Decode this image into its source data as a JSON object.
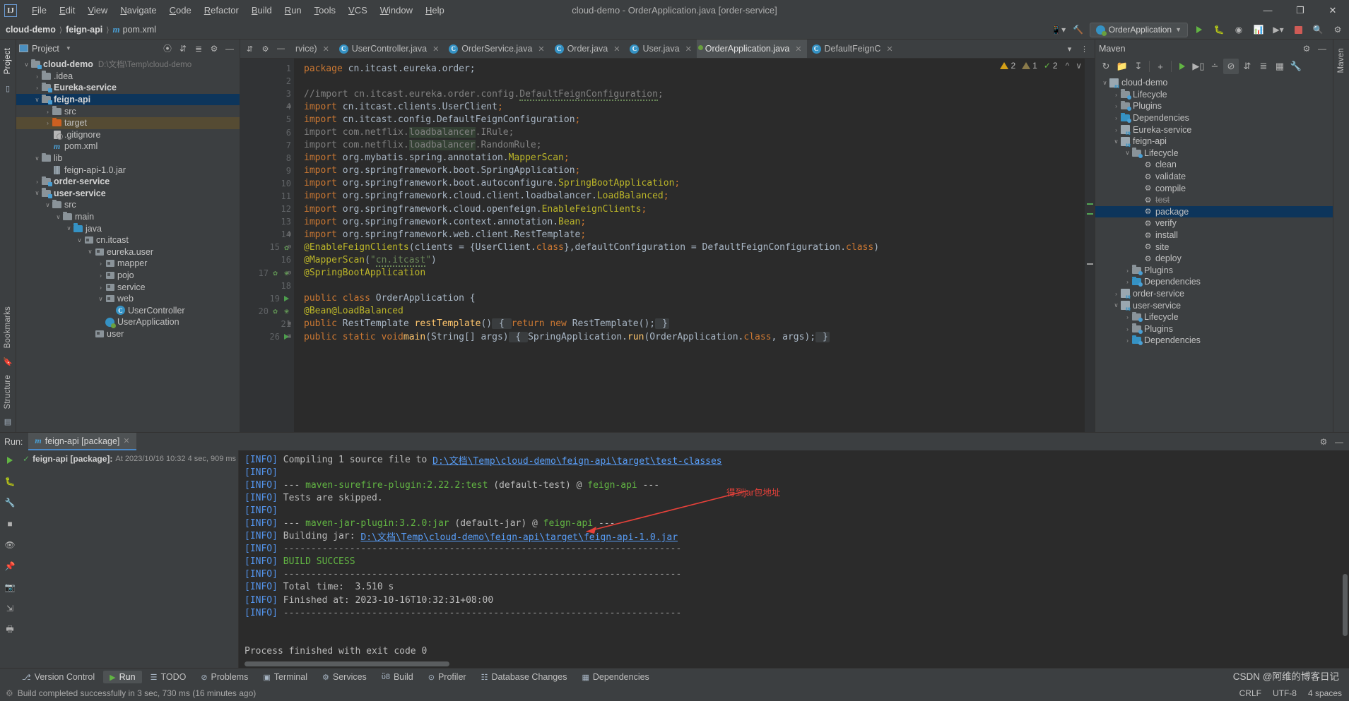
{
  "window": {
    "title": "cloud-demo - OrderApplication.java [order-service]",
    "logo": "IJ",
    "minimize": "—",
    "maximize": "❐",
    "close": "✕"
  },
  "menu": [
    "File",
    "Edit",
    "View",
    "Navigate",
    "Code",
    "Refactor",
    "Build",
    "Run",
    "Tools",
    "VCS",
    "Window",
    "Help"
  ],
  "navbar": {
    "breadcrumbs": [
      "cloud-demo",
      "feign-api",
      "pom.xml"
    ],
    "run_config": "OrderApplication",
    "icons": [
      "device-manager-icon",
      "build-hammer-icon",
      "run-icon",
      "debug-icon",
      "profiler-icon",
      "coverage-icon",
      "more-run-icon",
      "stop-icon",
      "search-everywhere-icon",
      "settings-icon"
    ]
  },
  "left_strip": {
    "tabs": [
      "Project"
    ],
    "bottom_tabs": [
      "Bookmarks",
      "Structure"
    ]
  },
  "project_panel": {
    "title": "Project",
    "header_icons": [
      "locate-icon",
      "collapse-all-icon",
      "expand-icon",
      "settings-icon",
      "hide-icon"
    ],
    "tree": [
      {
        "depth": 0,
        "arrow": "∨",
        "icon": "module-folder",
        "label": "cloud-demo",
        "bold": true,
        "hint": "D:\\文档\\Temp\\cloud-demo"
      },
      {
        "depth": 1,
        "arrow": "›",
        "icon": "folder",
        "label": ".idea"
      },
      {
        "depth": 1,
        "arrow": "›",
        "icon": "module-folder",
        "label": "Eureka-service",
        "bold": true
      },
      {
        "depth": 1,
        "arrow": "∨",
        "icon": "module-folder",
        "label": "feign-api",
        "bold": true,
        "state": "selected"
      },
      {
        "depth": 2,
        "arrow": "›",
        "icon": "folder",
        "label": "src"
      },
      {
        "depth": 2,
        "arrow": "›",
        "icon": "folder-orange",
        "label": "target",
        "state": "secondary"
      },
      {
        "depth": 2,
        "arrow": "",
        "icon": "gitignore",
        "label": ".gitignore"
      },
      {
        "depth": 2,
        "arrow": "",
        "icon": "maven-m",
        "label": "pom.xml"
      },
      {
        "depth": 1,
        "arrow": "∨",
        "icon": "folder",
        "label": "lib"
      },
      {
        "depth": 2,
        "arrow": "",
        "icon": "jar",
        "label": "feign-api-1.0.jar"
      },
      {
        "depth": 1,
        "arrow": "›",
        "icon": "module-folder",
        "label": "order-service",
        "bold": true
      },
      {
        "depth": 1,
        "arrow": "∨",
        "icon": "module-folder",
        "label": "user-service",
        "bold": true
      },
      {
        "depth": 2,
        "arrow": "∨",
        "icon": "folder",
        "label": "src"
      },
      {
        "depth": 3,
        "arrow": "∨",
        "icon": "folder",
        "label": "main"
      },
      {
        "depth": 4,
        "arrow": "∨",
        "icon": "folder-blue",
        "label": "java"
      },
      {
        "depth": 5,
        "arrow": "∨",
        "icon": "package",
        "label": "cn.itcast"
      },
      {
        "depth": 6,
        "arrow": "∨",
        "icon": "package",
        "label": "eureka.user"
      },
      {
        "depth": 7,
        "arrow": "›",
        "icon": "package",
        "label": "mapper"
      },
      {
        "depth": 7,
        "arrow": "›",
        "icon": "package",
        "label": "pojo"
      },
      {
        "depth": 7,
        "arrow": "›",
        "icon": "package",
        "label": "service"
      },
      {
        "depth": 7,
        "arrow": "∨",
        "icon": "package",
        "label": "web"
      },
      {
        "depth": 8,
        "arrow": "",
        "icon": "class",
        "label": "UserController"
      },
      {
        "depth": 7,
        "arrow": "",
        "icon": "spring-class",
        "label": "UserApplication"
      },
      {
        "depth": 6,
        "arrow": "",
        "icon": "package",
        "label": "user"
      }
    ]
  },
  "editor": {
    "lead_icons": [
      "collapse-icon",
      "settings-icon",
      "hide-icon"
    ],
    "tabs": [
      {
        "label": "rvice)",
        "icon": "",
        "active": false,
        "partial": true
      },
      {
        "label": "UserController.java",
        "icon": "class",
        "active": false
      },
      {
        "label": "OrderService.java",
        "icon": "class",
        "active": false
      },
      {
        "label": "Order.java",
        "icon": "class",
        "active": false
      },
      {
        "label": "User.java",
        "icon": "class",
        "active": false
      },
      {
        "label": "OrderApplication.java",
        "icon": "spring-class",
        "active": true
      },
      {
        "label": "DefaultFeignC",
        "icon": "class",
        "active": false
      }
    ],
    "tail_icons": [
      "chevron-down-icon",
      "more-vertical-icon"
    ],
    "inspection": {
      "warnings": "2",
      "weak_warnings": "1",
      "checks": "2",
      "up": "⌃",
      "down": "⌄"
    },
    "lines": [
      {
        "n": "1",
        "marks": [],
        "fold": "",
        "html": "<span class=\"kw\">package</span> cn.itcast.eureka.order;"
      },
      {
        "n": "2",
        "marks": [],
        "fold": "",
        "html": ""
      },
      {
        "n": "3",
        "marks": [],
        "fold": "",
        "html": "<span class=\"cmt\">//import cn.itcast.eureka.order.config.<span class=\"squig\">DefaultFeignConfiguration</span>;</span>"
      },
      {
        "n": "4",
        "marks": [],
        "fold": "⊖",
        "html": "<span class=\"kw\">import</span> cn.itcast.clients.UserClient<span class=\"kw\">;</span>"
      },
      {
        "n": "5",
        "marks": [],
        "fold": "",
        "html": "<span class=\"kw\">import</span> cn.itcast.config.DefaultFeignConfiguration<span class=\"kw\">;</span>"
      },
      {
        "n": "6",
        "marks": [],
        "fold": "",
        "html": "<span class=\"gray\">import com.netflix.<span class=\"hl\">loadbalancer</span>.IRule;</span>"
      },
      {
        "n": "7",
        "marks": [],
        "fold": "",
        "html": "<span class=\"gray\">import com.netflix.<span class=\"hl\">loadbalancer</span>.RandomRule;</span>"
      },
      {
        "n": "8",
        "marks": [],
        "fold": "",
        "html": "<span class=\"kw\">import</span> org.mybatis.spring.annotation.<span class=\"ann\">MapperScan</span><span class=\"kw\">;</span>"
      },
      {
        "n": "9",
        "marks": [],
        "fold": "",
        "html": "<span class=\"kw\">import</span> org.springframework.boot.SpringApplication<span class=\"kw\">;</span>"
      },
      {
        "n": "10",
        "marks": [],
        "fold": "",
        "html": "<span class=\"kw\">import</span> org.springframework.boot.autoconfigure.<span class=\"ann\">SpringBootApplication</span><span class=\"kw\">;</span>"
      },
      {
        "n": "11",
        "marks": [],
        "fold": "",
        "html": "<span class=\"kw\">import</span> org.springframework.cloud.client.loadbalancer.<span class=\"ann\">LoadBalanced</span><span class=\"kw\">;</span>"
      },
      {
        "n": "12",
        "marks": [],
        "fold": "",
        "html": "<span class=\"kw\">import</span> org.springframework.cloud.openfeign.<span class=\"ann\">EnableFeignClients</span><span class=\"kw\">;</span>"
      },
      {
        "n": "13",
        "marks": [],
        "fold": "",
        "html": "<span class=\"kw\">import</span> org.springframework.context.annotation.<span class=\"ann\">Bean</span><span class=\"kw\">;</span>"
      },
      {
        "n": "14",
        "marks": [],
        "fold": "⊖",
        "html": "<span class=\"kw\">import</span> org.springframework.web.client.RestTemplate<span class=\"kw\">;</span>"
      },
      {
        "n": "15",
        "marks": [
          "bean"
        ],
        "fold": "⊖",
        "html": "<span class=\"ann\">@EnableFeignClients</span>(clients = {UserClient.<span class=\"kw\">class</span>},defaultConfiguration = DefaultFeignConfiguration.<span class=\"kw\">class</span>)"
      },
      {
        "n": "16",
        "marks": [],
        "fold": "",
        "html": "<span class=\"ann\">@MapperScan</span>(<span class=\"str\">\"<span class=\"squig\">cn.itcast</span>\"</span>)"
      },
      {
        "n": "17",
        "marks": [
          "bean",
          "leaf"
        ],
        "fold": "⊖",
        "html": "<span class=\"ann\">@SpringBootApplication</span>"
      },
      {
        "n": "18",
        "marks": [],
        "fold": "",
        "html": ""
      },
      {
        "n": "19",
        "marks": [
          "run"
        ],
        "fold": "",
        "html": "<span class=\"kw\">public class</span> OrderApplication {"
      },
      {
        "n": "20",
        "marks": [
          "bean",
          "leaf"
        ],
        "fold": "",
        "html": "    <span class=\"ann\">@Bean</span> <span class=\"ann\">@LoadBalanced</span>"
      },
      {
        "n": "21",
        "marks": [],
        "fold": "⊞",
        "html": "    <span class=\"kw\">public</span> RestTemplate <span class=\"meth\">restTemplate</span>()<span class=\"codefold\"> { </span><span class=\"kw\">return new</span> RestTemplate();<span class=\"codefold\"> }</span>"
      },
      {
        "n": "26",
        "marks": [
          "run"
        ],
        "fold": "⊞",
        "html": "    <span class=\"kw\">public static void</span> <span class=\"meth\">main</span>(String[] args)<span class=\"codefold\"> { </span>SpringApplication.<span class=\"meth\">run</span>(OrderApplication.<span class=\"kw\">class</span>, args);<span class=\"codefold\"> }</span>"
      }
    ]
  },
  "maven_panel": {
    "title": "Maven",
    "header_icons": [
      "settings-icon",
      "hide-icon"
    ],
    "toolbar_icons": [
      "refresh-icon",
      "add-maven-project-icon",
      "download-sources-icon",
      "add-icon",
      "run-icon",
      "execute-goal-icon",
      "toggle-skip-tests-icon",
      "toggle-offline-icon",
      "collapse-all-icon",
      "expand-all-icon",
      "show-diagram-icon",
      "settings-icon"
    ],
    "tree": [
      {
        "depth": 0,
        "arrow": "∨",
        "icon": "maven-project",
        "label": "cloud-demo"
      },
      {
        "depth": 1,
        "arrow": "›",
        "icon": "lifecycle-folder",
        "label": "Lifecycle"
      },
      {
        "depth": 1,
        "arrow": "›",
        "icon": "plugins-folder",
        "label": "Plugins"
      },
      {
        "depth": 1,
        "arrow": "›",
        "icon": "deps-folder",
        "label": "Dependencies"
      },
      {
        "depth": 1,
        "arrow": "›",
        "icon": "maven-project",
        "label": "Eureka-service"
      },
      {
        "depth": 1,
        "arrow": "∨",
        "icon": "maven-project",
        "label": "feign-api"
      },
      {
        "depth": 2,
        "arrow": "∨",
        "icon": "lifecycle-folder",
        "label": "Lifecycle"
      },
      {
        "depth": 3,
        "arrow": "",
        "icon": "goal",
        "label": "clean"
      },
      {
        "depth": 3,
        "arrow": "",
        "icon": "goal",
        "label": "validate"
      },
      {
        "depth": 3,
        "arrow": "",
        "icon": "goal",
        "label": "compile"
      },
      {
        "depth": 3,
        "arrow": "",
        "icon": "goal",
        "label": "test",
        "state": "struck"
      },
      {
        "depth": 3,
        "arrow": "",
        "icon": "goal",
        "label": "package",
        "state": "selected"
      },
      {
        "depth": 3,
        "arrow": "",
        "icon": "goal",
        "label": "verify"
      },
      {
        "depth": 3,
        "arrow": "",
        "icon": "goal",
        "label": "install"
      },
      {
        "depth": 3,
        "arrow": "",
        "icon": "goal",
        "label": "site"
      },
      {
        "depth": 3,
        "arrow": "",
        "icon": "goal",
        "label": "deploy"
      },
      {
        "depth": 2,
        "arrow": "›",
        "icon": "plugins-folder",
        "label": "Plugins"
      },
      {
        "depth": 2,
        "arrow": "›",
        "icon": "deps-folder",
        "label": "Dependencies"
      },
      {
        "depth": 1,
        "arrow": "›",
        "icon": "maven-project",
        "label": "order-service"
      },
      {
        "depth": 1,
        "arrow": "∨",
        "icon": "maven-project",
        "label": "user-service"
      },
      {
        "depth": 2,
        "arrow": "›",
        "icon": "lifecycle-folder",
        "label": "Lifecycle"
      },
      {
        "depth": 2,
        "arrow": "›",
        "icon": "plugins-folder",
        "label": "Plugins"
      },
      {
        "depth": 2,
        "arrow": "›",
        "icon": "deps-folder",
        "label": "Dependencies"
      }
    ]
  },
  "run_panel": {
    "label": "Run:",
    "tab": "feign-api [package]",
    "header_icons": [
      "settings-icon",
      "hide-icon"
    ],
    "side_icons": [
      "rerun-icon",
      "debug-icon",
      "wrench-icon",
      "stop-icon",
      "eye-icon",
      "pin-icon",
      "camera-icon",
      "export-icon",
      "print-icon"
    ],
    "tree_item": {
      "status": "✓",
      "name": "feign-api [package]:",
      "meta": "At 2023/10/16 10:32 4 sec, 909 ms"
    },
    "right_icons": [
      "wrap-icon",
      "scroll-end-icon",
      "settings2-icon"
    ],
    "console": [
      {
        "tag": "[INFO]",
        "text": " Compiling 1 source file to ",
        "link": "D:\\文档\\Temp\\cloud-demo\\feign-api\\target\\test-classes"
      },
      {
        "tag": "[INFO]",
        "text": ""
      },
      {
        "tag": "[INFO]",
        "text": " --- ",
        "plugin": "maven-surefire-plugin:2.22.2:test",
        "mid": " (default-test) @ ",
        "module": "feign-api",
        "tail": " ---"
      },
      {
        "tag": "[INFO]",
        "text": " Tests are skipped."
      },
      {
        "tag": "[INFO]",
        "text": ""
      },
      {
        "tag": "[INFO]",
        "text": " --- ",
        "plugin": "maven-jar-plugin:3.2.0:jar",
        "mid": " (default-jar) @ ",
        "module": "feign-api",
        "tail": " ---"
      },
      {
        "tag": "[INFO]",
        "text": " Building jar: ",
        "link": "D:\\文档\\Temp\\cloud-demo\\feign-api\\target\\feign-api-1.0.jar"
      },
      {
        "tag": "[INFO]",
        "text": " ------------------------------------------------------------------------",
        "dash": true
      },
      {
        "tag": "[INFO]",
        "text": " BUILD SUCCESS",
        "success": true
      },
      {
        "tag": "[INFO]",
        "text": " ------------------------------------------------------------------------",
        "dash": true
      },
      {
        "tag": "[INFO]",
        "text": " Total time:  3.510 s"
      },
      {
        "tag": "[INFO]",
        "text": " Finished at: 2023-10-16T10:32:31+08:00"
      },
      {
        "tag": "[INFO]",
        "text": " ------------------------------------------------------------------------",
        "dash": true
      },
      {
        "tag": "",
        "text": ""
      },
      {
        "tag": "",
        "text": ""
      },
      {
        "tag": "",
        "text": "Process finished with exit code 0"
      }
    ],
    "annotation": "得到jar包地址"
  },
  "toolwindow_bar": [
    {
      "label": "Version Control",
      "icon": "branch-icon",
      "active": false
    },
    {
      "label": "Run",
      "icon": "run-icon",
      "active": true
    },
    {
      "label": "TODO",
      "icon": "todo-icon",
      "active": false
    },
    {
      "label": "Problems",
      "icon": "problems-icon",
      "active": false
    },
    {
      "label": "Terminal",
      "icon": "terminal-icon",
      "active": false
    },
    {
      "label": "Services",
      "icon": "services-icon",
      "active": false
    },
    {
      "label": "Build",
      "icon": "build-icon",
      "active": false
    },
    {
      "label": "Profiler",
      "icon": "profiler-icon",
      "active": false
    },
    {
      "label": "Database Changes",
      "icon": "database-icon",
      "active": false
    },
    {
      "label": "Dependencies",
      "icon": "dependencies-icon",
      "active": false
    }
  ],
  "statusbar": {
    "message": "Build completed successfully in 3 sec, 730 ms (16 minutes ago)",
    "line_sep": "CRLF",
    "encoding": "UTF-8",
    "indent": "4 spaces"
  },
  "watermark": "CSDN @阿维的博客日记",
  "colors": {
    "accent": "#4a88c7",
    "selection": "#0d355b",
    "editor_bg": "#2b2b2b",
    "panel_bg": "#3c3f41",
    "annotation_red": "#e8413a",
    "success_green": "#62b543"
  }
}
